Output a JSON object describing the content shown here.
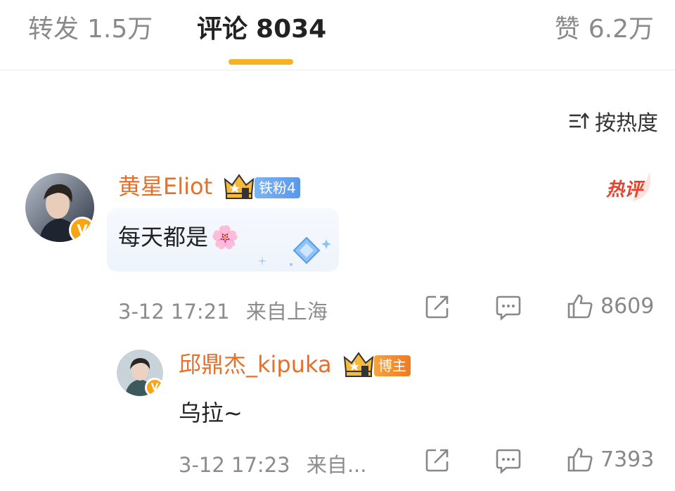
{
  "tabs": {
    "repost": {
      "label": "转发",
      "count": "1.5万"
    },
    "comments": {
      "label": "评论",
      "count": "8034"
    },
    "likes": {
      "label": "赞",
      "count": "6.2万"
    }
  },
  "sort": {
    "label": "按热度"
  },
  "comments": [
    {
      "username": "黄星Eliot",
      "fan_badge": "铁粉4",
      "hot_tag": "热评",
      "text": "每天都是",
      "emoji": "🌸",
      "time": "3-12 17:21",
      "location": "来自上海",
      "likes": "8609"
    },
    {
      "username": "邱鼎杰_kipuka",
      "fan_badge": "博主",
      "text": "乌拉~",
      "time": "3-12 17:23",
      "location": "来自...",
      "likes": "7393"
    }
  ],
  "colors": {
    "accent": "#f7b125",
    "username": "#e4702c",
    "hot": "#e8412d"
  }
}
